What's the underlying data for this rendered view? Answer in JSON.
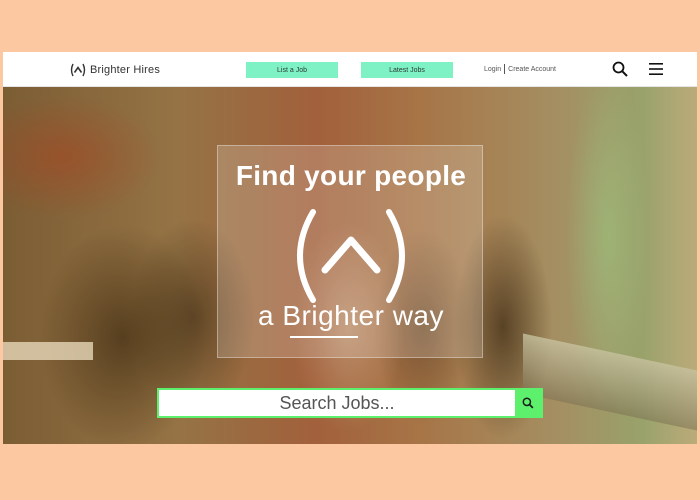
{
  "brand": {
    "name": "Brighter Hires",
    "icon": "caret-circle-logo-icon"
  },
  "nav": {
    "list_job": "List a Job",
    "latest_jobs": "Latest Jobs",
    "login": "Login",
    "create_account": "Create Account",
    "search_icon": "search-icon",
    "menu_icon": "hamburger-menu-icon"
  },
  "hero": {
    "headline": "Find your people",
    "tagline": "a Brighter way"
  },
  "search": {
    "placeholder": "Search Jobs..."
  },
  "colors": {
    "background": "#fcc8a2",
    "pill": "#7ef2c4",
    "search_accent": "#5cf06c"
  }
}
